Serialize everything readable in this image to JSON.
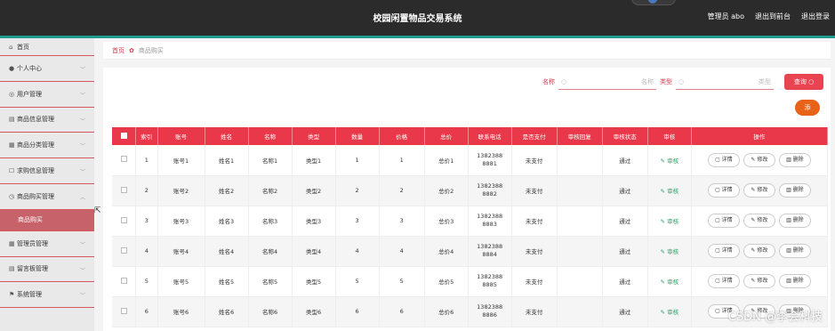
{
  "header": {
    "title": "校园闲置物品交易系统",
    "admin_label": "管理员 abo",
    "back_label": "退出到前台",
    "logout_label": "退出登录"
  },
  "sidebar": {
    "items": [
      {
        "label": "首页",
        "icon": "home-icon",
        "glyph": "⌂"
      },
      {
        "label": "个人中心",
        "icon": "user-icon",
        "glyph": "●"
      },
      {
        "label": "用户管理",
        "icon": "users-icon",
        "glyph": "◎"
      },
      {
        "label": "商品信息管理",
        "icon": "goods-icon",
        "glyph": "▤"
      },
      {
        "label": "商品分类管理",
        "icon": "category-icon",
        "glyph": "▦"
      },
      {
        "label": "求购信息管理",
        "icon": "request-icon",
        "glyph": "☐"
      },
      {
        "label": "商品购买管理",
        "icon": "purchase-icon",
        "glyph": "◷"
      },
      {
        "label": "商品购买",
        "sub": true
      },
      {
        "label": "管理员管理",
        "icon": "admin-icon",
        "glyph": "▦"
      },
      {
        "label": "留言板管理",
        "icon": "message-icon",
        "glyph": "▤"
      },
      {
        "label": "系统管理",
        "icon": "system-icon",
        "glyph": "⚑"
      }
    ]
  },
  "breadcrumb": {
    "home": "首页",
    "current": "商品购买"
  },
  "search": {
    "name_label": "名称",
    "name_placeholder": "名称",
    "type_label": "类型",
    "type_placeholder": "类型",
    "query_button": "查询"
  },
  "add_button": "添",
  "table": {
    "headers": [
      "索引",
      "账号",
      "姓名",
      "名称",
      "类型",
      "数量",
      "价格",
      "总价",
      "联系电话",
      "是否支付",
      "审核回复",
      "审核状态",
      "审核",
      "操作"
    ],
    "rows": [
      {
        "idx": "1",
        "account": "账号1",
        "name": "姓名1",
        "title": "名称1",
        "type": "类型1",
        "qty": "1",
        "price": "1",
        "total": "总价1",
        "phone": "13823888881",
        "paid": "未支付",
        "reply": "",
        "status": "通过"
      },
      {
        "idx": "2",
        "account": "账号2",
        "name": "姓名2",
        "title": "名称2",
        "type": "类型2",
        "qty": "2",
        "price": "2",
        "total": "总价2",
        "phone": "13823888882",
        "paid": "未支付",
        "reply": "",
        "status": "通过"
      },
      {
        "idx": "3",
        "account": "账号3",
        "name": "姓名3",
        "title": "名称3",
        "type": "类型3",
        "qty": "3",
        "price": "3",
        "total": "总价3",
        "phone": "13823888883",
        "paid": "未支付",
        "reply": "",
        "status": "通过"
      },
      {
        "idx": "4",
        "account": "账号4",
        "name": "姓名4",
        "title": "名称4",
        "type": "类型4",
        "qty": "4",
        "price": "4",
        "total": "总价4",
        "phone": "13823888884",
        "paid": "未支付",
        "reply": "",
        "status": "通过"
      },
      {
        "idx": "5",
        "account": "账号5",
        "name": "姓名5",
        "title": "名称5",
        "type": "类型5",
        "qty": "5",
        "price": "5",
        "total": "总价5",
        "phone": "13823888885",
        "paid": "未支付",
        "reply": "",
        "status": "通过"
      },
      {
        "idx": "6",
        "account": "账号6",
        "name": "姓名6",
        "title": "名称6",
        "type": "类型6",
        "qty": "6",
        "price": "6",
        "total": "总价6",
        "phone": "13823888886",
        "paid": "未支付",
        "reply": "",
        "status": "通过"
      }
    ],
    "audit_label": "审核",
    "detail_label": "详情",
    "edit_label": "修改",
    "delete_label": "删除"
  },
  "watermark": "CSDN @李会科技",
  "colors": {
    "accent": "#e8384a",
    "topbar": "#2b2b2b",
    "teal": "#1e9c8f",
    "sidebar_active": "#c7616a"
  }
}
